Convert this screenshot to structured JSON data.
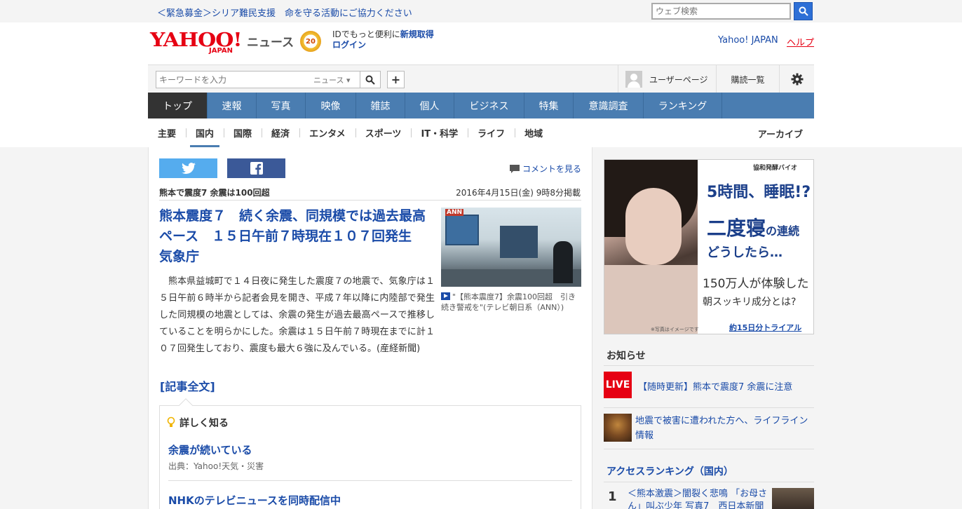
{
  "top": {
    "emergency": "＜緊急募金＞シリア難民支援　命を守る活動にご協力ください",
    "web_search_placeholder": "ウェブ検索"
  },
  "header": {
    "logo_yahoo": "YAHOO!",
    "logo_japan": "JAPAN",
    "logo_news": "ニュース",
    "badge": "20",
    "promo_prefix": "IDでもっと便利に",
    "promo_signup": "新規取得",
    "login": "ログイン",
    "yahoo_japan_link": "Yahoo! JAPAN",
    "help_link": "ヘルプ"
  },
  "search": {
    "placeholder": "キーワードを入力",
    "category": "ニュース",
    "user_page": "ユーザーページ",
    "subscriptions": "購読一覧"
  },
  "nav": {
    "items": [
      {
        "label": "トップ",
        "w": 85
      },
      {
        "label": "速報",
        "w": 70
      },
      {
        "label": "写真",
        "w": 70
      },
      {
        "label": "映像",
        "w": 72
      },
      {
        "label": "雑誌",
        "w": 70
      },
      {
        "label": "個人",
        "w": 70
      },
      {
        "label": "ビジネス",
        "w": 100
      },
      {
        "label": "特集",
        "w": 70
      },
      {
        "label": "意識調査",
        "w": 100
      },
      {
        "label": "ランキング",
        "w": 112
      }
    ],
    "sub_items": [
      "主要",
      "国内",
      "国際",
      "経済",
      "エンタメ",
      "スポーツ",
      "IT・科学",
      "ライフ",
      "地域"
    ],
    "archive": "アーカイブ"
  },
  "article": {
    "comment_link": "コメントを見る",
    "topic": "熊本で震度7 余震は100回超",
    "date": "2016年4月15日(金) 9時8分掲載",
    "headline": "熊本震度７　続く余震、同規模では過去最高ペース　１５日午前７時現在１０７回発生　気象庁",
    "body": "熊本県益城町で１４日夜に発生した震度７の地震で、気象庁は１５日午前６時半から記者会見を開き、平成７年以降に内陸部で発生した同規模の地震としては、余震の発生が過去最高ペースで推移していることを明らかにした。余震は１５日午前７時現在までに計１０７回発生しており、震度も最大６強に及んでいる。(産経新聞)",
    "full_link": "[記事全文]",
    "photo_logo": "ANN",
    "photo_caption": "\"【熊本震度7】余震100回超　引き続き警戒を\"(テレビ朝日系（ANN）)"
  },
  "learn": {
    "title": "詳しく知る",
    "item1_title": "余震が続いている",
    "item1_source": "出典：Yahoo!天気・災害",
    "item2_title": "NHKのテレビニュースを同時配信中"
  },
  "ad": {
    "brand": "協和発酵バイオ",
    "line1": "5時間、睡眠!?",
    "line2": "二度寝",
    "line2_suffix": "の連続",
    "line3": "どうしたら…",
    "line4": "150万人が体験した",
    "line5": "朝スッキリ成分とは?",
    "note": "※写真はイメージです",
    "cta": "約15日分トライアル>>"
  },
  "notice": {
    "title": "お知らせ",
    "live": "LIVE",
    "item1": "【随時更新】熊本で震度7 余震に注意",
    "item2": "地震で被害に遭われた方へ、ライフライン情報"
  },
  "ranking": {
    "title": "アクセスランキング（国内）",
    "num": "1",
    "item1": "＜熊本激震＞闇裂く悲鳴 「お母さん」叫ぶ少年 写真7　西日本新聞"
  },
  "colors": {
    "nav_bg": "#4a7db1",
    "brand_red": "#e60013",
    "link": "#1a4ba8",
    "twitter": "#55acee",
    "facebook": "#3b5998"
  }
}
